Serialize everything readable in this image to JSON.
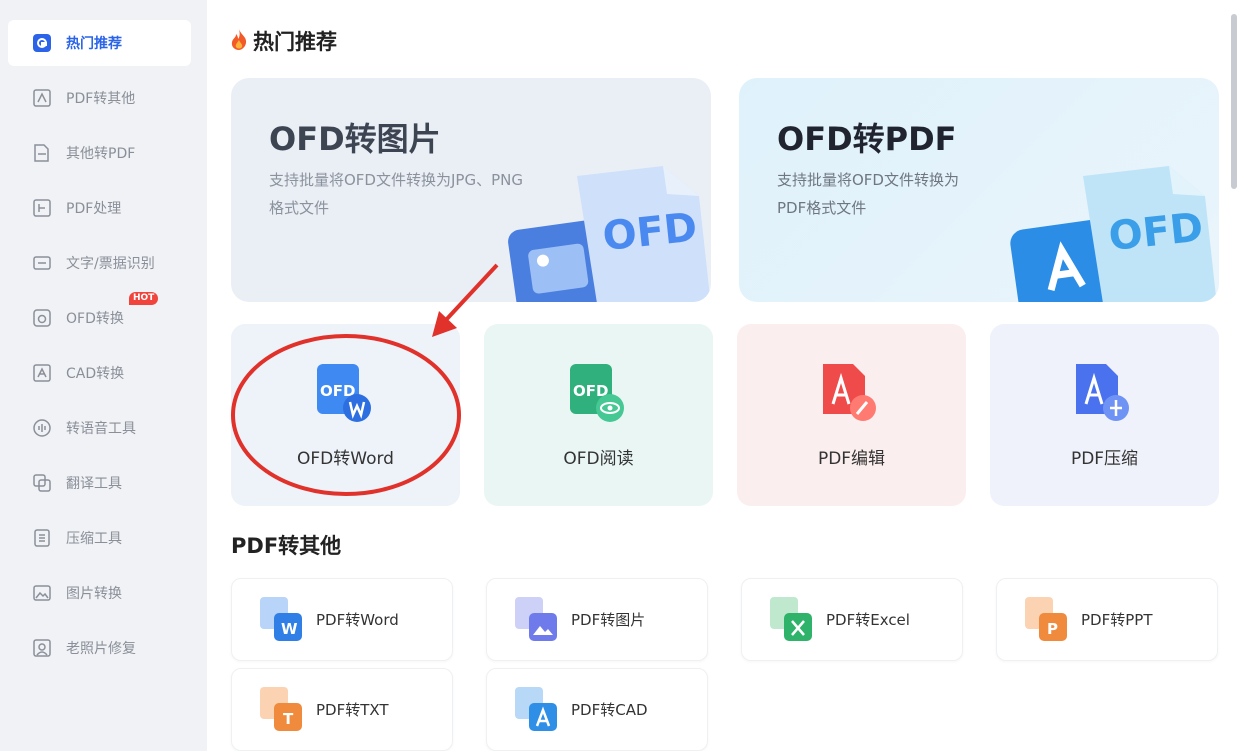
{
  "sidebar": {
    "items": [
      {
        "label": "热门推荐",
        "icon": "home-icon",
        "active": true
      },
      {
        "label": "PDF转其他",
        "icon": "pdf-export-icon"
      },
      {
        "label": "其他转PDF",
        "icon": "pdf-import-icon"
      },
      {
        "label": "PDF处理",
        "icon": "pdf-process-icon"
      },
      {
        "label": "文字/票据识别",
        "icon": "ocr-icon"
      },
      {
        "label": "OFD转换",
        "icon": "ofd-icon",
        "badge": "HOT"
      },
      {
        "label": "CAD转换",
        "icon": "cad-icon"
      },
      {
        "label": "转语音工具",
        "icon": "voice-icon"
      },
      {
        "label": "翻译工具",
        "icon": "translate-icon"
      },
      {
        "label": "压缩工具",
        "icon": "compress-icon"
      },
      {
        "label": "图片转换",
        "icon": "image-icon"
      },
      {
        "label": "老照片修复",
        "icon": "photo-repair-icon"
      }
    ]
  },
  "main": {
    "hot_title": "热门推荐",
    "banners": [
      {
        "title": "OFD转图片",
        "desc": "支持批量将OFD文件转换为JPG、PNG格式文件"
      },
      {
        "title": "OFD转PDF",
        "desc": "支持批量将OFD文件转换为PDF格式文件"
      }
    ],
    "tiles": [
      {
        "label": "OFD转Word"
      },
      {
        "label": "OFD阅读"
      },
      {
        "label": "PDF编辑"
      },
      {
        "label": "PDF压缩"
      }
    ],
    "pdf_title": "PDF转其他",
    "pdf_tools": [
      {
        "label": "PDF转Word",
        "color": "#2f7fe6"
      },
      {
        "label": "PDF转图片",
        "color": "#6f7bea"
      },
      {
        "label": "PDF转Excel",
        "color": "#2fb36b"
      },
      {
        "label": "PDF转PPT",
        "color": "#f08a3c"
      },
      {
        "label": "PDF转TXT",
        "color": "#f08a3c"
      },
      {
        "label": "PDF转CAD",
        "color": "#2f8fe6"
      }
    ],
    "banner_icon_text": "OFD",
    "tile_icon_text": "OFD"
  },
  "colors": {
    "accent": "#2b64e8",
    "hot": "#f0443c",
    "annotation": "#e0312a"
  }
}
